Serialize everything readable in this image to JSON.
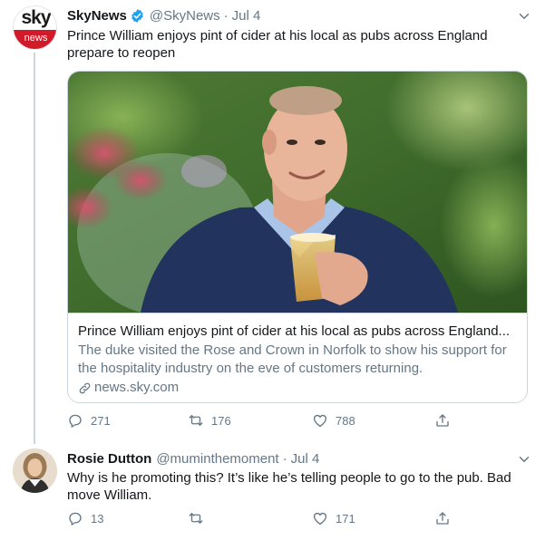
{
  "tweet1": {
    "avatar_top": "sky",
    "avatar_bottom": "news",
    "name": "SkyNews",
    "handle": "@SkyNews",
    "separator": "·",
    "date": "Jul 4",
    "text": "Prince William enjoys pint of cider at his local as pubs across England prepare to reopen",
    "card": {
      "title": "Prince William enjoys pint of cider at his local as pubs across England...",
      "description": "The duke visited the Rose and Crown in Norfolk to show his support for the hospitality industry on the eve of customers returning.",
      "link": "news.sky.com"
    },
    "actions": {
      "replies": "271",
      "retweets": "176",
      "likes": "788"
    }
  },
  "tweet2": {
    "name": "Rosie Dutton",
    "handle": "@muminthemoment",
    "separator": "·",
    "date": "Jul 4",
    "text": "Why is he promoting this? It’s like he’s telling people to go to the pub. Bad move William.",
    "actions": {
      "replies": "13",
      "retweets": "",
      "likes": "171"
    }
  },
  "colors": {
    "text": "#14171a",
    "secondary": "#657786",
    "border": "#ccd6dd",
    "verified": "#1da1f2",
    "sky_red": "#d11a2a"
  },
  "icons": [
    "verified-badge-icon",
    "caret-down-icon",
    "reply-icon",
    "retweet-icon",
    "like-icon",
    "share-icon",
    "link-icon"
  ]
}
